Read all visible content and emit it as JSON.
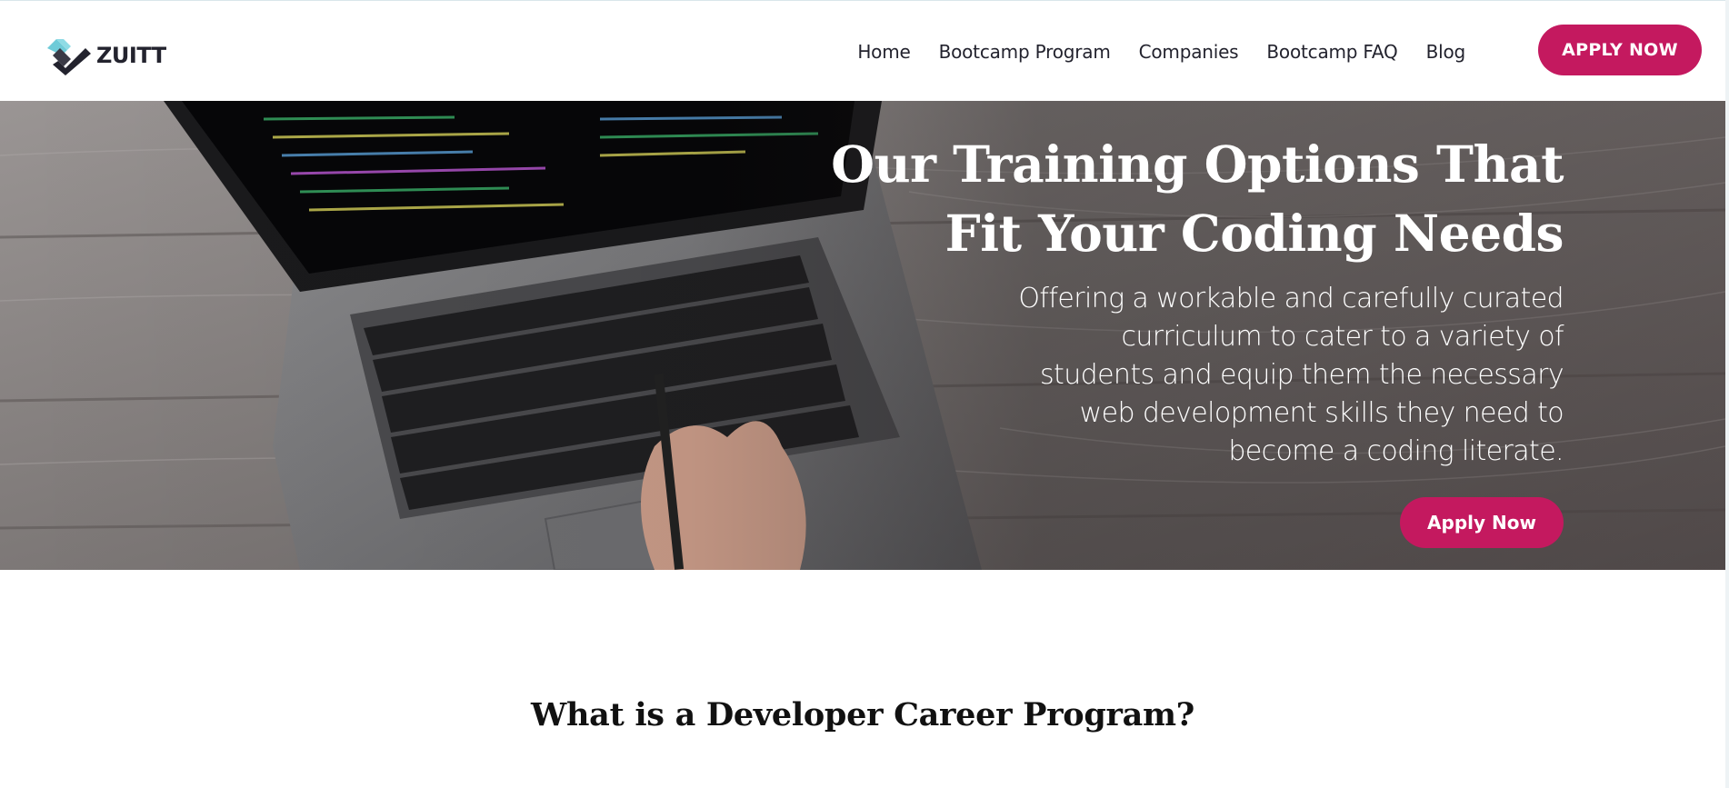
{
  "brand": {
    "name": "ZUITT",
    "accent": "#c4195f",
    "logo_teal": "#6fcbd8",
    "logo_dark": "#23232e"
  },
  "nav": {
    "items": [
      {
        "label": "Home"
      },
      {
        "label": "Bootcamp Program"
      },
      {
        "label": "Companies"
      },
      {
        "label": "Bootcamp FAQ"
      },
      {
        "label": "Blog"
      }
    ],
    "cta_label": "APPLY NOW"
  },
  "hero": {
    "title_line1": "Our Training Options That",
    "title_line2": "Fit Your Coding Needs",
    "subtitle": "Offering a workable and carefully curated curriculum to cater to a variety of students and equip them the necessary web development skills they need to become a coding literate.",
    "cta_label": "Apply Now",
    "image_icon": "laptop-on-wood-desk-photo"
  },
  "section": {
    "title": "What is a Developer Career Program?"
  }
}
